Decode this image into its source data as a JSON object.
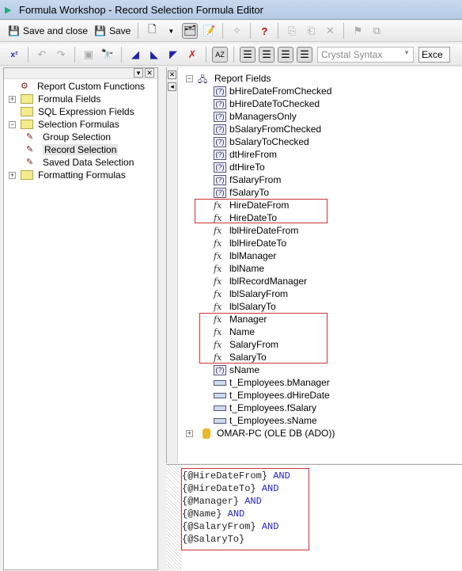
{
  "window": {
    "title": "Formula Workshop - Record Selection Formula Editor"
  },
  "toolbar": {
    "save_close_label": "Save and close",
    "save_label": "Save",
    "syntax_select": "Crystal Syntax",
    "error_select": "Exce"
  },
  "left_tree": {
    "items": [
      {
        "label": "Report Custom Functions",
        "expander": "",
        "icon": "custom-function-icon",
        "indent": 0
      },
      {
        "label": "Formula Fields",
        "expander": "+",
        "icon": "folder-icon",
        "indent": 0
      },
      {
        "label": "SQL Expression Fields",
        "expander": "",
        "icon": "folder-icon",
        "indent": 0
      },
      {
        "label": "Selection Formulas",
        "expander": "−",
        "icon": "folder-icon",
        "indent": 0
      },
      {
        "label": "Group Selection",
        "expander": "",
        "icon": "selection-formula-icon",
        "indent": 1
      },
      {
        "label": "Record Selection",
        "expander": "",
        "icon": "selection-formula-icon",
        "indent": 1,
        "selected": true
      },
      {
        "label": "Saved Data Selection",
        "expander": "",
        "icon": "selection-formula-icon",
        "indent": 1
      },
      {
        "label": "Formatting Formulas",
        "expander": "+",
        "icon": "folder-icon",
        "indent": 0
      }
    ]
  },
  "field_tree": {
    "root": "Report Fields",
    "items": [
      {
        "label": "bHireDateFromChecked",
        "type": "param"
      },
      {
        "label": "bHireDateToChecked",
        "type": "param"
      },
      {
        "label": "bManagersOnly",
        "type": "param"
      },
      {
        "label": "bSalaryFromChecked",
        "type": "param"
      },
      {
        "label": "bSalaryToChecked",
        "type": "param"
      },
      {
        "label": "dtHireFrom",
        "type": "param"
      },
      {
        "label": "dtHireTo",
        "type": "param"
      },
      {
        "label": "fSalaryFrom",
        "type": "param"
      },
      {
        "label": "fSalaryTo",
        "type": "param"
      },
      {
        "label": "HireDateFrom",
        "type": "formula"
      },
      {
        "label": "HireDateTo",
        "type": "formula"
      },
      {
        "label": "lblHireDateFrom",
        "type": "formula"
      },
      {
        "label": "lblHireDateTo",
        "type": "formula"
      },
      {
        "label": "lblManager",
        "type": "formula"
      },
      {
        "label": "lblName",
        "type": "formula"
      },
      {
        "label": "lblRecordManager",
        "type": "formula"
      },
      {
        "label": "lblSalaryFrom",
        "type": "formula"
      },
      {
        "label": "lblSalaryTo",
        "type": "formula"
      },
      {
        "label": "Manager",
        "type": "formula"
      },
      {
        "label": "Name",
        "type": "formula"
      },
      {
        "label": "SalaryFrom",
        "type": "formula"
      },
      {
        "label": "SalaryTo",
        "type": "formula"
      },
      {
        "label": "sName",
        "type": "param"
      },
      {
        "label": "t_Employees.bManager",
        "type": "field"
      },
      {
        "label": "t_Employees.dHireDate",
        "type": "field"
      },
      {
        "label": "t_Employees.fSalary",
        "type": "field"
      },
      {
        "label": "t_Employees.sName",
        "type": "field"
      }
    ],
    "datasource": "OMAR-PC (OLE DB (ADO))"
  },
  "editor": {
    "lines": [
      {
        "ref": "{@HireDateFrom}",
        "kw": "AND"
      },
      {
        "ref": "{@HireDateTo}",
        "kw": "AND"
      },
      {
        "ref": "{@Manager}",
        "kw": "AND"
      },
      {
        "ref": "{@Name}",
        "kw": "AND"
      },
      {
        "ref": "{@SalaryFrom}",
        "kw": "AND"
      },
      {
        "ref": "{@SalaryTo}",
        "kw": ""
      }
    ]
  },
  "colors": {
    "highlight_box": "#cc3333",
    "keyword": "#2222cc"
  }
}
